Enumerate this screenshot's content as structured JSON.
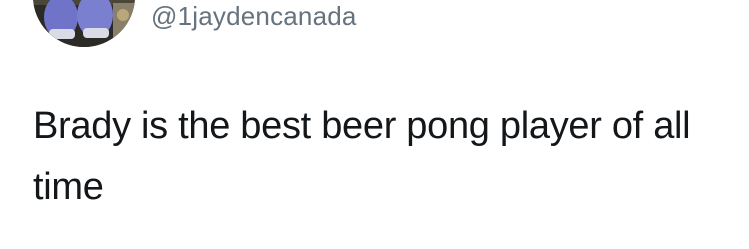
{
  "tweet": {
    "handle": "@1jaydencanada",
    "text": "Brady is the best beer pong player of all time"
  },
  "avatar": {
    "alt": "profile-avatar",
    "colors": {
      "background": "#3b3a33",
      "shoe_blue": "#6f74c9",
      "shoe_white": "#d9dbe6",
      "floor": "#8a8069"
    }
  }
}
